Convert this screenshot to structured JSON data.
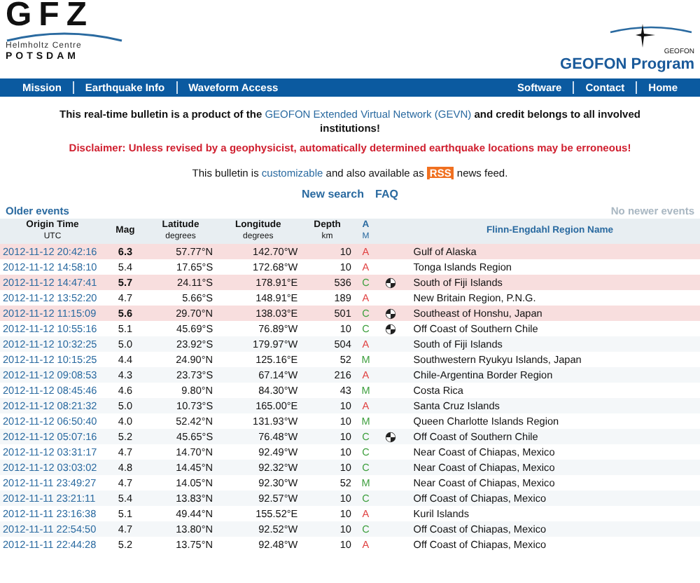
{
  "logo": {
    "name": "GFZ",
    "subtitle_1": "Helmholtz Centre",
    "subtitle_2": "POTSDAM"
  },
  "program": {
    "emblem": "GEOFON",
    "title": "GEOFON Program"
  },
  "nav_left": [
    "Mission",
    "Earthquake Info",
    "Waveform Access"
  ],
  "nav_right": [
    "Software",
    "Contact",
    "Home"
  ],
  "intro": {
    "before": "This real-time bulletin is a product of the",
    "link": "GEOFON Extended Virtual Network (GEVN)",
    "after": "and credit belongs to all involved institutions!"
  },
  "disclaimer": "Disclaimer: Unless revised by a geophysicist, automatically determined earthquake locations may be erroneous!",
  "bulletin": {
    "before": "This bulletin is",
    "link": "customizable",
    "middle": "and also available as",
    "badge": "RSS",
    "after": "news feed."
  },
  "links": [
    "New search",
    "FAQ"
  ],
  "older": "Older events",
  "newer": "No newer events",
  "columns": [
    {
      "label": "Origin Time",
      "sub": "UTC"
    },
    {
      "label": "Mag"
    },
    {
      "label": "Latitude",
      "sub": "degrees"
    },
    {
      "label": "Longitude",
      "sub": "degrees"
    },
    {
      "label": "Depth",
      "sub": "km"
    },
    {
      "label": "A",
      "sub": "M"
    },
    {
      "label": "Flinn-Engdahl Region Name"
    }
  ],
  "rows": [
    {
      "time": "2012-11-12 20:42:16",
      "mag": "6.3",
      "lat": "57.77°N",
      "lon": "142.70°W",
      "depth": "10",
      "status": "A",
      "color": "#e04040",
      "mechanism": false,
      "highlighted": true,
      "region": "Gulf of Alaska"
    },
    {
      "time": "2012-11-12 14:58:10",
      "mag": "5.4",
      "lat": "17.65°S",
      "lon": "172.68°W",
      "depth": "10",
      "status": "A",
      "color": "#e04040",
      "mechanism": false,
      "highlighted": false,
      "region": "Tonga Islands Region"
    },
    {
      "time": "2012-11-12 14:47:41",
      "mag": "5.7",
      "lat": "24.11°S",
      "lon": "178.91°E",
      "depth": "536",
      "status": "C",
      "color": "#40a040",
      "mechanism": true,
      "highlighted": true,
      "region": "South of Fiji Islands"
    },
    {
      "time": "2012-11-12 13:52:20",
      "mag": "4.7",
      "lat": "5.66°S",
      "lon": "148.91°E",
      "depth": "189",
      "status": "A",
      "color": "#e04040",
      "mechanism": false,
      "highlighted": false,
      "region": "New Britain Region, P.N.G."
    },
    {
      "time": "2012-11-12 11:15:09",
      "mag": "5.6",
      "lat": "29.70°N",
      "lon": "138.03°E",
      "depth": "501",
      "status": "C",
      "color": "#40a040",
      "mechanism": true,
      "highlighted": true,
      "region": "Southeast of Honshu, Japan"
    },
    {
      "time": "2012-11-12 10:55:16",
      "mag": "5.1",
      "lat": "45.69°S",
      "lon": "76.89°W",
      "depth": "10",
      "status": "C",
      "color": "#40a040",
      "mechanism": true,
      "highlighted": false,
      "region": "Off Coast of Southern Chile"
    },
    {
      "time": "2012-11-12 10:32:25",
      "mag": "5.0",
      "lat": "23.92°S",
      "lon": "179.97°W",
      "depth": "504",
      "status": "A",
      "color": "#e04040",
      "mechanism": false,
      "highlighted": false,
      "region": "South of Fiji Islands"
    },
    {
      "time": "2012-11-12 10:15:25",
      "mag": "4.4",
      "lat": "24.90°N",
      "lon": "125.16°E",
      "depth": "52",
      "status": "M",
      "color": "#40a040",
      "mechanism": false,
      "highlighted": false,
      "region": "Southwestern Ryukyu Islands, Japan"
    },
    {
      "time": "2012-11-12 09:08:53",
      "mag": "4.3",
      "lat": "23.73°S",
      "lon": "67.14°W",
      "depth": "216",
      "status": "A",
      "color": "#e04040",
      "mechanism": false,
      "highlighted": false,
      "region": "Chile-Argentina Border Region"
    },
    {
      "time": "2012-11-12 08:45:46",
      "mag": "4.6",
      "lat": "9.80°N",
      "lon": "84.30°W",
      "depth": "43",
      "status": "M",
      "color": "#40a040",
      "mechanism": false,
      "highlighted": false,
      "region": "Costa Rica"
    },
    {
      "time": "2012-11-12 08:21:32",
      "mag": "5.0",
      "lat": "10.73°S",
      "lon": "165.00°E",
      "depth": "10",
      "status": "A",
      "color": "#e04040",
      "mechanism": false,
      "highlighted": false,
      "region": "Santa Cruz Islands"
    },
    {
      "time": "2012-11-12 06:50:40",
      "mag": "4.0",
      "lat": "52.42°N",
      "lon": "131.93°W",
      "depth": "10",
      "status": "M",
      "color": "#40a040",
      "mechanism": false,
      "highlighted": false,
      "region": "Queen Charlotte Islands Region"
    },
    {
      "time": "2012-11-12 05:07:16",
      "mag": "5.2",
      "lat": "45.65°S",
      "lon": "76.48°W",
      "depth": "10",
      "status": "C",
      "color": "#40a040",
      "mechanism": true,
      "highlighted": false,
      "region": "Off Coast of Southern Chile"
    },
    {
      "time": "2012-11-12 03:31:17",
      "mag": "4.7",
      "lat": "14.70°N",
      "lon": "92.49°W",
      "depth": "10",
      "status": "C",
      "color": "#40a040",
      "mechanism": false,
      "highlighted": false,
      "region": "Near Coast of Chiapas, Mexico"
    },
    {
      "time": "2012-11-12 03:03:02",
      "mag": "4.8",
      "lat": "14.45°N",
      "lon": "92.32°W",
      "depth": "10",
      "status": "C",
      "color": "#40a040",
      "mechanism": false,
      "highlighted": false,
      "region": "Near Coast of Chiapas, Mexico"
    },
    {
      "time": "2012-11-11 23:49:27",
      "mag": "4.7",
      "lat": "14.05°N",
      "lon": "92.30°W",
      "depth": "52",
      "status": "M",
      "color": "#40a040",
      "mechanism": false,
      "highlighted": false,
      "region": "Near Coast of Chiapas, Mexico"
    },
    {
      "time": "2012-11-11 23:21:11",
      "mag": "5.4",
      "lat": "13.83°N",
      "lon": "92.57°W",
      "depth": "10",
      "status": "C",
      "color": "#40a040",
      "mechanism": false,
      "highlighted": false,
      "region": "Off Coast of Chiapas, Mexico"
    },
    {
      "time": "2012-11-11 23:16:38",
      "mag": "5.1",
      "lat": "49.44°N",
      "lon": "155.52°E",
      "depth": "10",
      "status": "A",
      "color": "#e04040",
      "mechanism": false,
      "highlighted": false,
      "region": "Kuril Islands"
    },
    {
      "time": "2012-11-11 22:54:50",
      "mag": "4.7",
      "lat": "13.80°N",
      "lon": "92.52°W",
      "depth": "10",
      "status": "C",
      "color": "#40a040",
      "mechanism": false,
      "highlighted": false,
      "region": "Off Coast of Chiapas, Mexico"
    },
    {
      "time": "2012-11-11 22:44:28",
      "mag": "5.2",
      "lat": "13.75°N",
      "lon": "92.48°W",
      "depth": "10",
      "status": "A",
      "color": "#e04040",
      "mechanism": false,
      "highlighted": false,
      "region": "Off Coast of Chiapas, Mexico"
    }
  ]
}
